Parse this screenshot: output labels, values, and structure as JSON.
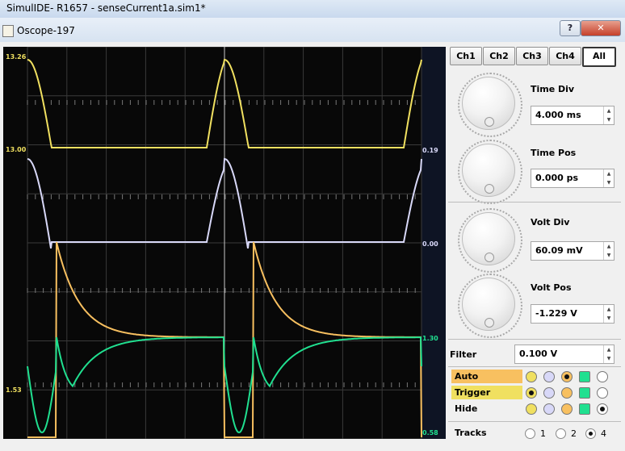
{
  "app": {
    "title": "SimulIDE- R1657 - senseCurrent1a.sim1*"
  },
  "window": {
    "title": "Oscope-197",
    "help_label": "?",
    "close_label": "✕"
  },
  "scope": {
    "labels": {
      "ch1_top": "13.26",
      "ch1_bottom": "13.00",
      "ch2_top": "0.19",
      "ch2_bottom": "0.00",
      "ch4_top": "1.30",
      "ch4_left": "1.53",
      "ch4_bottom": "0.58"
    },
    "colors": {
      "ch1": "#f0e060",
      "ch2": "#d8d8f8",
      "ch3": "#f8c060",
      "ch4": "#20e090"
    }
  },
  "panel": {
    "channels": [
      "Ch1",
      "Ch2",
      "Ch3",
      "Ch4",
      "All"
    ],
    "active_channel": "All",
    "time_div": {
      "label": "Time Div",
      "value": "4.000 ms"
    },
    "time_pos": {
      "label": "Time Pos",
      "value": "0.000 ps"
    },
    "volt_div": {
      "label": "Volt Div",
      "value": "60.09 mV"
    },
    "volt_pos": {
      "label": "Volt Pos",
      "value": "-1.229 V"
    },
    "filter": {
      "label": "Filter",
      "value": "0.100 V"
    },
    "rows": [
      {
        "label": "Auto",
        "color": "#f8c060",
        "selected": 2
      },
      {
        "label": "Trigger",
        "color": "#f0e060",
        "selected": 0
      },
      {
        "label": "Hide",
        "color": "",
        "selected": 4
      }
    ],
    "tracks": {
      "label": "Tracks",
      "options": [
        "1",
        "2",
        "4"
      ],
      "selected": "4"
    }
  }
}
